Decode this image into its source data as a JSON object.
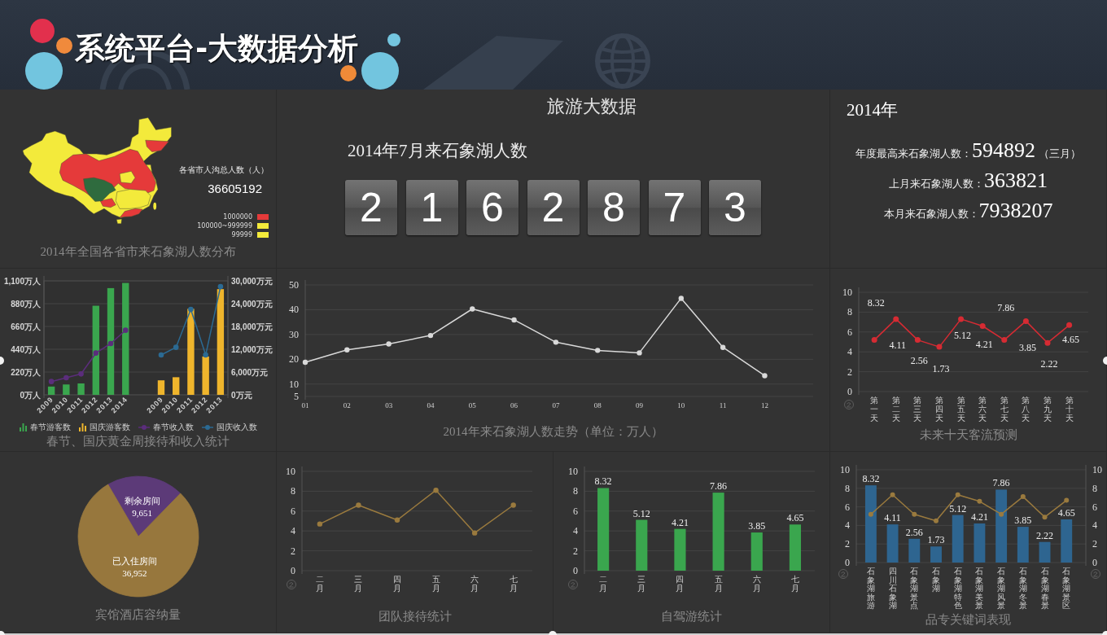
{
  "header": {
    "title": "系统平台-大数据分析"
  },
  "province_map": {
    "legend_title": "各省市人沟总人数（人）",
    "total": "36605192",
    "legend": [
      {
        "label": "1000000",
        "color": "#e53a3a"
      },
      {
        "label": "100000~999999",
        "color": "#f3ea3b"
      },
      {
        "label": "99999",
        "color": "#f3ea3b"
      }
    ],
    "caption": "2014年全国各省市来石象湖人数分布"
  },
  "tourism": {
    "title": "旅游大数据",
    "counter_label": "2014年7月来石象湖人数",
    "digits": [
      "2",
      "1",
      "6",
      "2",
      "8",
      "7",
      "3"
    ]
  },
  "yearly": {
    "year": "2014年",
    "stats": [
      {
        "label": "年度最高来石象湖人数：",
        "value": "594892",
        "note": "（三月）"
      },
      {
        "label": "上月来石象湖人数：",
        "value": "363821"
      },
      {
        "label": "本月来石象湖人数：",
        "value": "7938207"
      }
    ]
  },
  "golden_week": {
    "chart_data": {
      "type": "bar",
      "title": "春节、国庆黄金周接待和收入统计",
      "grid": true,
      "legend": "bottom",
      "categories": [
        "2009",
        "2010",
        "2011",
        "2012",
        "2013",
        "2014",
        "2009",
        "2010",
        "2011",
        "2012",
        "2013"
      ],
      "ylim": [
        0,
        1100
      ],
      "yticks": [
        {
          "value": 0,
          "label": "0万人"
        },
        {
          "value": 220,
          "label": "220万人"
        },
        {
          "value": 440,
          "label": "440万人"
        },
        {
          "value": 660,
          "label": "660万人"
        },
        {
          "value": 880,
          "label": "880万人"
        },
        {
          "value": 1100,
          "label": "1,100万人"
        }
      ],
      "y2lim": [
        0,
        30000
      ],
      "y2ticks": [
        {
          "value": 0,
          "label": "0万元"
        },
        {
          "value": 6000,
          "label": "6,000万元"
        },
        {
          "value": 12000,
          "label": "12,000万元"
        },
        {
          "value": 18000,
          "label": "18,000万元"
        },
        {
          "value": 24000,
          "label": "24,000万元"
        },
        {
          "value": 30000,
          "label": "30,000万元"
        }
      ],
      "series": [
        {
          "name": "春节游客数",
          "color": "#3aa64e",
          "values": [
            80,
            100,
            110,
            860,
            1030,
            1080,
            null,
            null,
            null,
            null,
            null
          ]
        },
        {
          "name": "国庆游客数",
          "color": "#efb52c",
          "values": [
            null,
            null,
            null,
            null,
            null,
            null,
            140,
            170,
            830,
            370,
            1020
          ]
        },
        {
          "name": "春节收入数",
          "type": "line",
          "axis": "y2",
          "marker": "circle",
          "color": "#5b2d7c",
          "values": [
            3500,
            4500,
            5500,
            11000,
            13500,
            17000,
            null,
            null,
            null,
            null,
            null
          ]
        },
        {
          "name": "国庆收入数",
          "type": "line",
          "axis": "y2",
          "marker": "circle",
          "color": "#2b6a93",
          "values": [
            null,
            null,
            null,
            null,
            null,
            null,
            10500,
            12500,
            22500,
            10500,
            28500
          ]
        }
      ]
    }
  },
  "visitor_trend": {
    "chart_data": {
      "type": "line",
      "title": "2014年来石象湖人数走势（单位：万人）",
      "grid": true,
      "categories": [
        "01",
        "02",
        "03",
        "04",
        "05",
        "06",
        "07",
        "08",
        "09",
        "10",
        "11",
        "12"
      ],
      "ylim": [
        5,
        50
      ],
      "yticks": [
        5,
        10,
        20,
        30,
        40,
        50
      ],
      "series": [
        {
          "color": "#d9d9d9",
          "marker": "circle",
          "values": [
            18.8,
            23.8,
            26.2,
            29.6,
            40.3,
            35.9,
            26.9,
            23.6,
            22.6,
            44.6,
            24.8,
            13.4
          ]
        }
      ]
    }
  },
  "forecast": {
    "chart_data": {
      "type": "line",
      "title": "未来十天客流预测",
      "grid": true,
      "categories": [
        "第一天",
        "第二天",
        "第三天",
        "第四天",
        "第五天",
        "第六天",
        "第七天",
        "第八天",
        "第九天",
        "第十天"
      ],
      "ylim": [
        0,
        10
      ],
      "yticks": [
        0,
        2,
        4,
        6,
        8,
        10
      ],
      "series": [
        {
          "color": "#d62b33",
          "marker": "circle",
          "values": [
            5.2,
            7.3,
            5.2,
            4.5,
            7.3,
            6.6,
            5.2,
            7.1,
            4.9,
            6.7
          ]
        }
      ],
      "annotations": [
        "8.32",
        "4.11",
        "2.56",
        "1.73",
        "5.12",
        "4.21",
        "7.86",
        "3.85",
        "2.22",
        "4.65"
      ]
    }
  },
  "hotel": {
    "chart_data": {
      "type": "pie",
      "title": "宾馆酒店容纳量",
      "categories": [
        "剩余房间",
        "已入住房间"
      ],
      "values": [
        9651,
        36952
      ],
      "value_labels": [
        "9,651",
        "36,952"
      ],
      "colors": [
        "#5c3a78",
        "#97773d"
      ]
    }
  },
  "team_reception": {
    "chart_data": {
      "type": "line",
      "title": "团队接待统计",
      "grid": true,
      "categories": [
        "二月",
        "三月",
        "四月",
        "五月",
        "六月",
        "七月"
      ],
      "ylim": [
        0,
        10
      ],
      "yticks": [
        0,
        2,
        4,
        6,
        8,
        10
      ],
      "series": [
        {
          "color": "#9a7a3e",
          "marker": "circle",
          "values": [
            4.7,
            6.6,
            5.1,
            8.1,
            3.8,
            6.6
          ]
        }
      ]
    }
  },
  "self_drive": {
    "chart_data": {
      "type": "bar",
      "title": "自驾游统计",
      "grid": true,
      "categories": [
        "二月",
        "三月",
        "四月",
        "五月",
        "六月",
        "七月"
      ],
      "ylim": [
        0,
        10
      ],
      "yticks": [
        0,
        2,
        4,
        6,
        8,
        10
      ],
      "data_labels": true,
      "series": [
        {
          "color": "#3aa64e",
          "values": [
            8.32,
            5.12,
            4.21,
            7.86,
            3.85,
            4.65
          ]
        }
      ]
    }
  },
  "keywords": {
    "chart_data": {
      "type": "bar",
      "title": "品专关键词表现",
      "grid": true,
      "categories": [
        "石象湖旅游",
        "四川石象湖",
        "石象湖景点",
        "石象湖",
        "石象湖特色",
        "石象湖美景",
        "石象湖风景",
        "石象湖冬景",
        "石象湖春景",
        "石象湖景区"
      ],
      "ylim": [
        0,
        10
      ],
      "yticks": [
        0,
        2,
        4,
        6,
        8,
        10
      ],
      "y2lim": [
        0,
        10
      ],
      "y2ticks": [
        0,
        2,
        4,
        6,
        8,
        10
      ],
      "series": [
        {
          "color": "#2e6590",
          "values": [
            8.32,
            4.11,
            2.56,
            1.73,
            5.12,
            4.21,
            7.86,
            3.85,
            2.22,
            4.65
          ],
          "value_labels": [
            "8.32",
            "4.11",
            "2.56",
            "1.73",
            "5.12",
            "4.21",
            "7.86",
            "3.85",
            "2.22",
            "4.65"
          ]
        },
        {
          "type": "line",
          "marker": "circle",
          "color": "#9a7a3e",
          "values": [
            5.2,
            7.3,
            5.2,
            4.5,
            7.3,
            6.6,
            5.2,
            7.1,
            4.9,
            6.7
          ]
        }
      ]
    }
  }
}
